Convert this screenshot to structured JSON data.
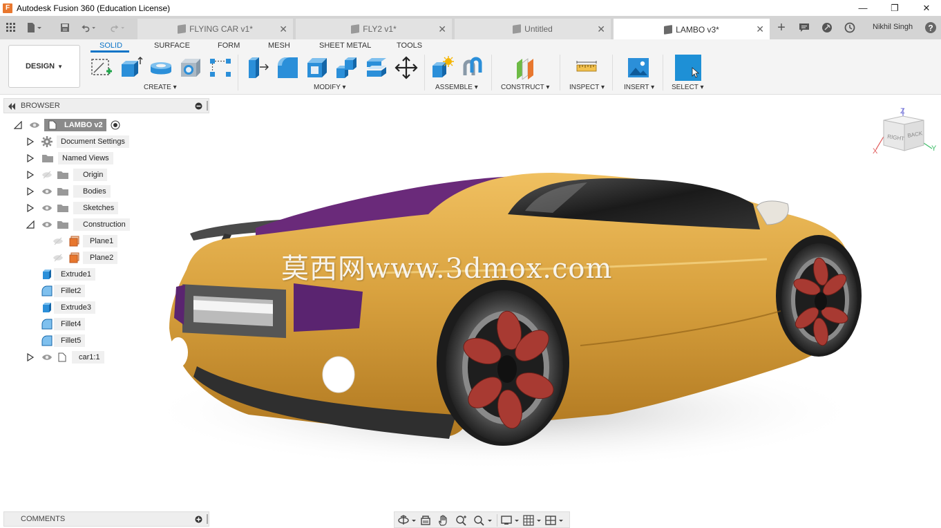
{
  "window": {
    "title": "Autodesk Fusion 360 (Education License)",
    "logo": "F"
  },
  "window_controls": {
    "minimize": "—",
    "restore": "❐",
    "close": "✕"
  },
  "tabs": [
    {
      "label": "FLYING CAR v1*",
      "active": false
    },
    {
      "label": "FLY2 v1*",
      "active": false
    },
    {
      "label": "Untitled",
      "active": false
    },
    {
      "label": "LAMBO v3*",
      "active": true
    }
  ],
  "tab_close_glyph": "✕",
  "new_tab_glyph": "+",
  "user": {
    "name": "Nikhil Singh"
  },
  "workspace": {
    "label": "DESIGN"
  },
  "workspace_tabs": [
    "SOLID",
    "SURFACE",
    "FORM",
    "MESH",
    "SHEET METAL",
    "TOOLS"
  ],
  "toolbar_groups": {
    "create": "CREATE",
    "modify": "MODIFY",
    "assemble": "ASSEMBLE",
    "construct": "CONSTRUCT",
    "inspect": "INSPECT",
    "insert": "INSERT",
    "select": "SELECT"
  },
  "browser": {
    "title": "BROWSER",
    "root": "LAMBO v2",
    "items": [
      "Document Settings",
      "Named Views",
      "Origin",
      "Bodies",
      "Sketches",
      "Construction",
      "Plane1",
      "Plane2",
      "Extrude1",
      "Fillet2",
      "Extrude3",
      "Fillet4",
      "Fillet5",
      "car1:1"
    ]
  },
  "watermark": "莫西网www.3dmox.com",
  "viewcube": {
    "faces": [
      "RIGHT",
      "BACK"
    ],
    "axes": [
      "Z",
      "X",
      "Y"
    ]
  },
  "comments": {
    "title": "COMMENTS"
  },
  "colors": {
    "accent": "#0c74c7",
    "car_body": "#d9a23f",
    "car_accent": "#6a2a7a",
    "wheel_hub": "#a83a32"
  }
}
